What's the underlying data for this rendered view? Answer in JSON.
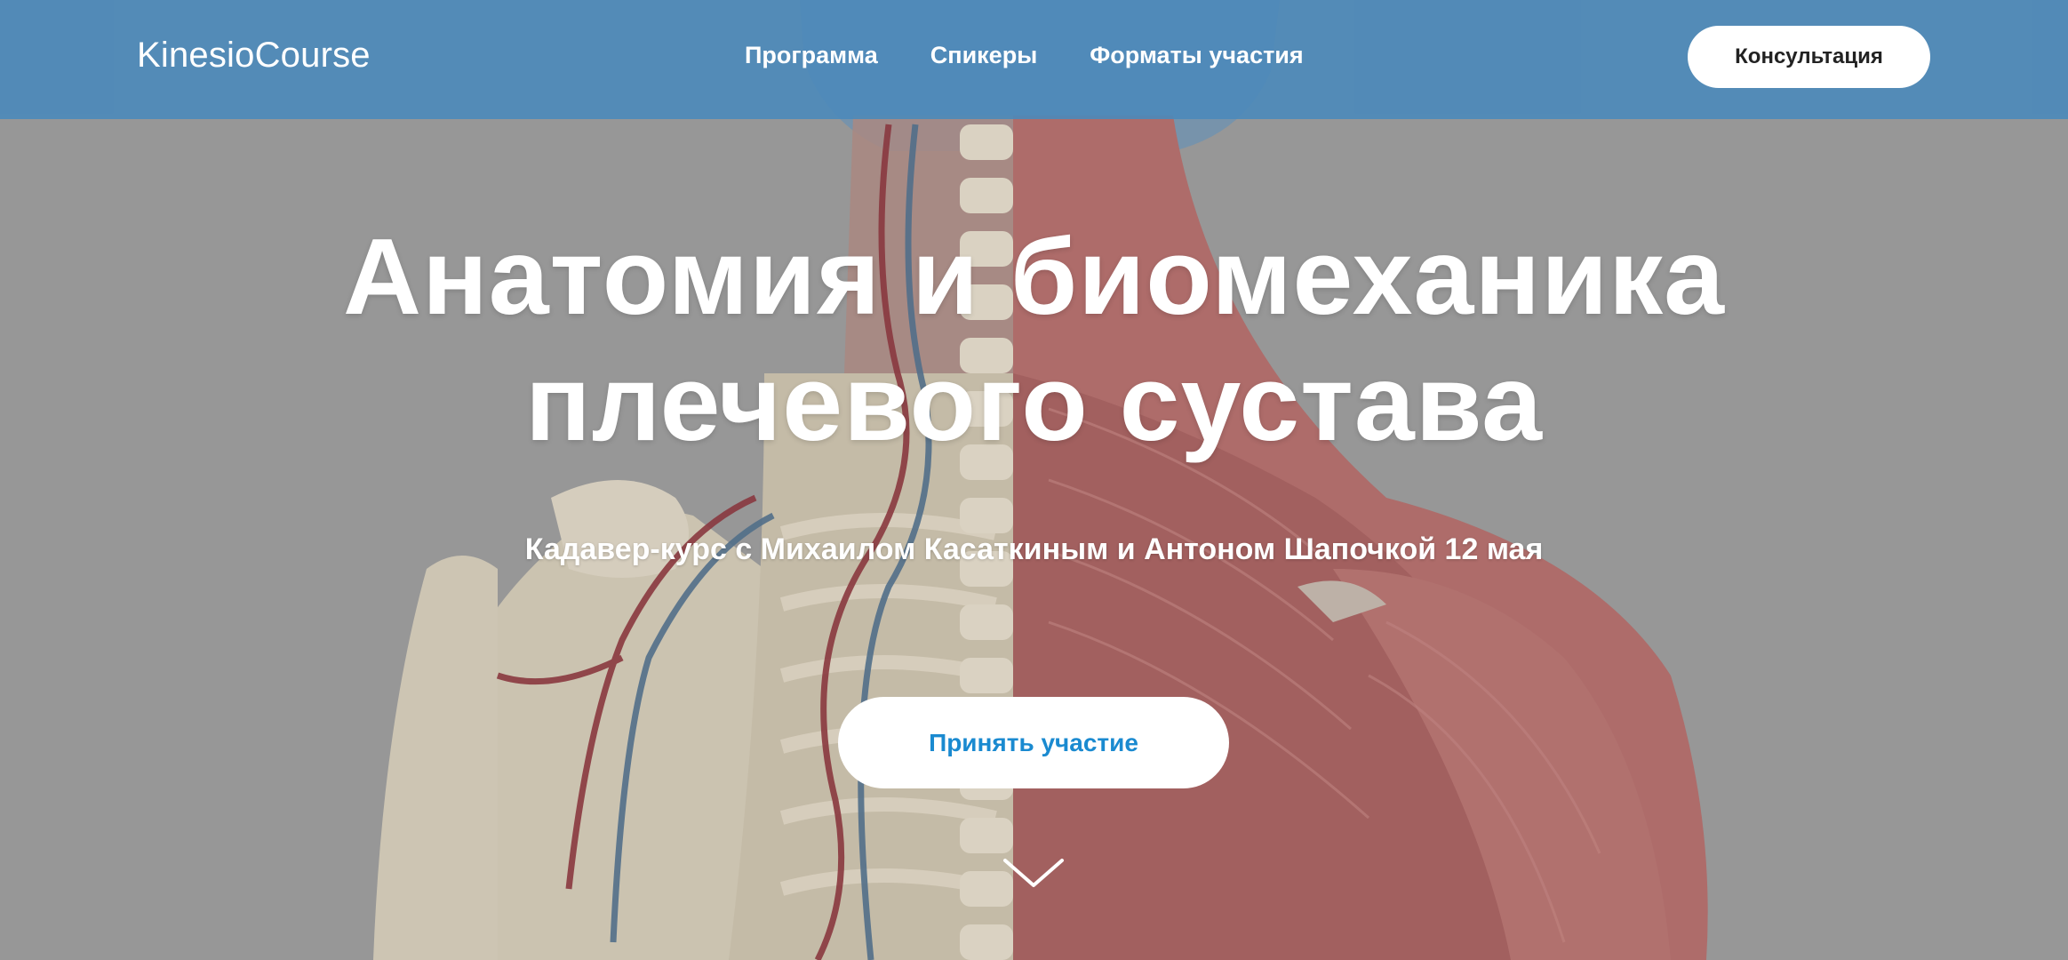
{
  "header": {
    "logo": "KinesioCourse",
    "nav": [
      {
        "label": "Программа"
      },
      {
        "label": "Спикеры"
      },
      {
        "label": "Форматы участия"
      }
    ],
    "consult_label": "Консультация"
  },
  "hero": {
    "title_line1": "Анатомия и биомеханика",
    "title_line2": "плечевого сустава",
    "subtitle": "Кадавер-курс с Михаилом Касаткиным и Антоном Шапочкой 12 мая",
    "cta_label": "Принять участие",
    "background": "anatomical illustration of the back and shoulder: skeleton with vessels on the left half, muscles on the right half",
    "scroll_icon": "chevron-down-icon"
  },
  "colors": {
    "navbar": "#4b89ba",
    "cta_text": "#1a8ad0",
    "text": "#ffffff",
    "background": "#9a9a9a"
  }
}
